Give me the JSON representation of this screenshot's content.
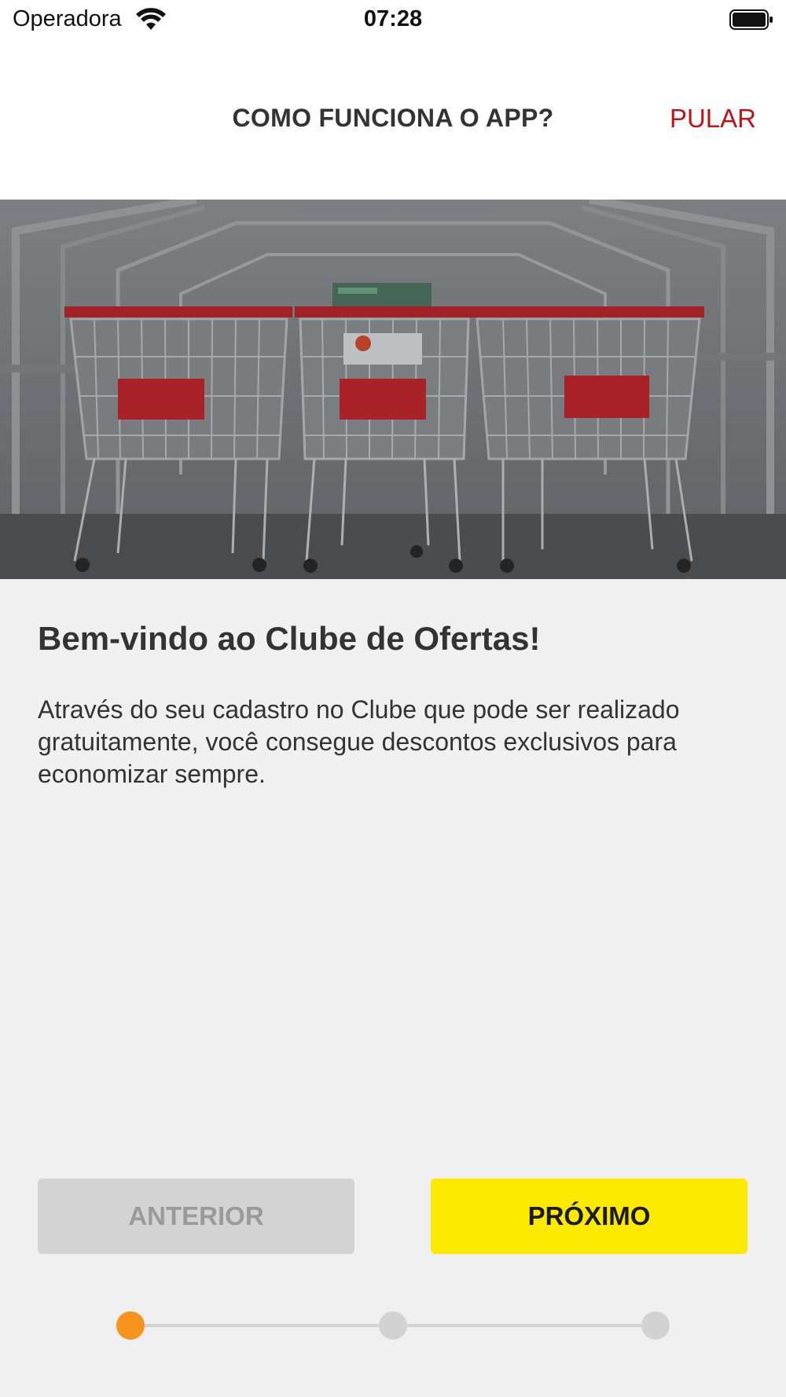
{
  "status_bar": {
    "carrier": "Operadora",
    "time": "07:28"
  },
  "header": {
    "title": "COMO FUNCIONA O APP?",
    "skip_label": "PULAR"
  },
  "hero": {
    "image_description_icon": "shopping-carts-photo"
  },
  "content": {
    "heading": "Bem-vindo ao Clube de Ofertas!",
    "body": "Através do seu cadastro no Clube que pode ser realizado gratuitamente, você consegue descontos exclusivos para economizar sempre."
  },
  "buttons": {
    "previous_label": "ANTERIOR",
    "next_label": "PRÓXIMO"
  },
  "stepper": {
    "total_steps": 3,
    "current_step": 1
  },
  "colors": {
    "accent_red": "#c1121a",
    "primary_yellow": "#fbea00",
    "step_active": "#f7941d",
    "step_inactive": "#d2d2d2",
    "disabled_button": "#d3d3d3"
  }
}
